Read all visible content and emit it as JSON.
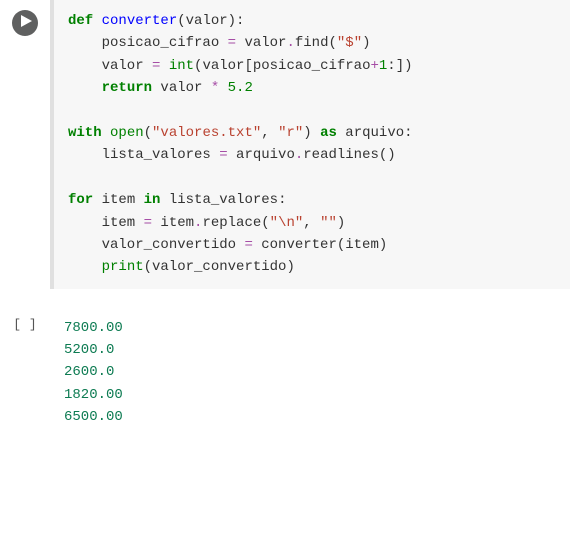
{
  "code_cell": {
    "tokens": [
      {
        "t": "def ",
        "c": "kw"
      },
      {
        "t": "converter",
        "c": "fn"
      },
      {
        "t": "(valor):",
        "c": "text"
      },
      {
        "t": "\n",
        "c": "text"
      },
      {
        "t": "    posicao_cifrao ",
        "c": "text"
      },
      {
        "t": "=",
        "c": "op"
      },
      {
        "t": " valor",
        "c": "text"
      },
      {
        "t": ".",
        "c": "op"
      },
      {
        "t": "find(",
        "c": "text"
      },
      {
        "t": "\"$\"",
        "c": "str"
      },
      {
        "t": ")",
        "c": "text"
      },
      {
        "t": "\n",
        "c": "text"
      },
      {
        "t": "    valor ",
        "c": "text"
      },
      {
        "t": "=",
        "c": "op"
      },
      {
        "t": " ",
        "c": "text"
      },
      {
        "t": "int",
        "c": "bi"
      },
      {
        "t": "(valor[posicao_cifrao",
        "c": "text"
      },
      {
        "t": "+",
        "c": "op"
      },
      {
        "t": "1",
        "c": "num"
      },
      {
        "t": ":])",
        "c": "text"
      },
      {
        "t": "\n",
        "c": "text"
      },
      {
        "t": "    ",
        "c": "text"
      },
      {
        "t": "return",
        "c": "kw"
      },
      {
        "t": " valor ",
        "c": "text"
      },
      {
        "t": "*",
        "c": "op"
      },
      {
        "t": " ",
        "c": "text"
      },
      {
        "t": "5.2",
        "c": "num"
      },
      {
        "t": "\n",
        "c": "text"
      },
      {
        "t": "\n",
        "c": "text"
      },
      {
        "t": "with",
        "c": "kw"
      },
      {
        "t": " ",
        "c": "text"
      },
      {
        "t": "open",
        "c": "bi"
      },
      {
        "t": "(",
        "c": "text"
      },
      {
        "t": "\"valores.txt\"",
        "c": "str"
      },
      {
        "t": ", ",
        "c": "text"
      },
      {
        "t": "\"r\"",
        "c": "str"
      },
      {
        "t": ") ",
        "c": "text"
      },
      {
        "t": "as",
        "c": "kw"
      },
      {
        "t": " arquivo:",
        "c": "text"
      },
      {
        "t": "\n",
        "c": "text"
      },
      {
        "t": "    lista_valores ",
        "c": "text"
      },
      {
        "t": "=",
        "c": "op"
      },
      {
        "t": " arquivo",
        "c": "text"
      },
      {
        "t": ".",
        "c": "op"
      },
      {
        "t": "readlines()",
        "c": "text"
      },
      {
        "t": "\n",
        "c": "text"
      },
      {
        "t": "\n",
        "c": "text"
      },
      {
        "t": "for",
        "c": "kw"
      },
      {
        "t": " item ",
        "c": "text"
      },
      {
        "t": "in",
        "c": "kw"
      },
      {
        "t": " lista_valores:",
        "c": "text"
      },
      {
        "t": "\n",
        "c": "text"
      },
      {
        "t": "    item ",
        "c": "text"
      },
      {
        "t": "=",
        "c": "op"
      },
      {
        "t": " item",
        "c": "text"
      },
      {
        "t": ".",
        "c": "op"
      },
      {
        "t": "replace(",
        "c": "text"
      },
      {
        "t": "\"\\n\"",
        "c": "str"
      },
      {
        "t": ", ",
        "c": "text"
      },
      {
        "t": "\"\"",
        "c": "str"
      },
      {
        "t": ")",
        "c": "text"
      },
      {
        "t": "\n",
        "c": "text"
      },
      {
        "t": "    valor_convertido ",
        "c": "text"
      },
      {
        "t": "=",
        "c": "op"
      },
      {
        "t": " converter(item)",
        "c": "text"
      },
      {
        "t": "\n",
        "c": "text"
      },
      {
        "t": "    ",
        "c": "text"
      },
      {
        "t": "print",
        "c": "bi"
      },
      {
        "t": "(valor_convertido)",
        "c": "text"
      },
      {
        "t": "\n",
        "c": "text"
      }
    ]
  },
  "output_cell": {
    "marker": "[ ]",
    "lines": [
      "7800.00",
      "5200.0",
      "2600.0",
      "1820.00",
      "6500.00"
    ]
  },
  "chart_data": {
    "type": "table",
    "title": "Execution output",
    "values": [
      7800.0,
      5200.0,
      2600.0,
      1820.0,
      6500.0
    ]
  }
}
